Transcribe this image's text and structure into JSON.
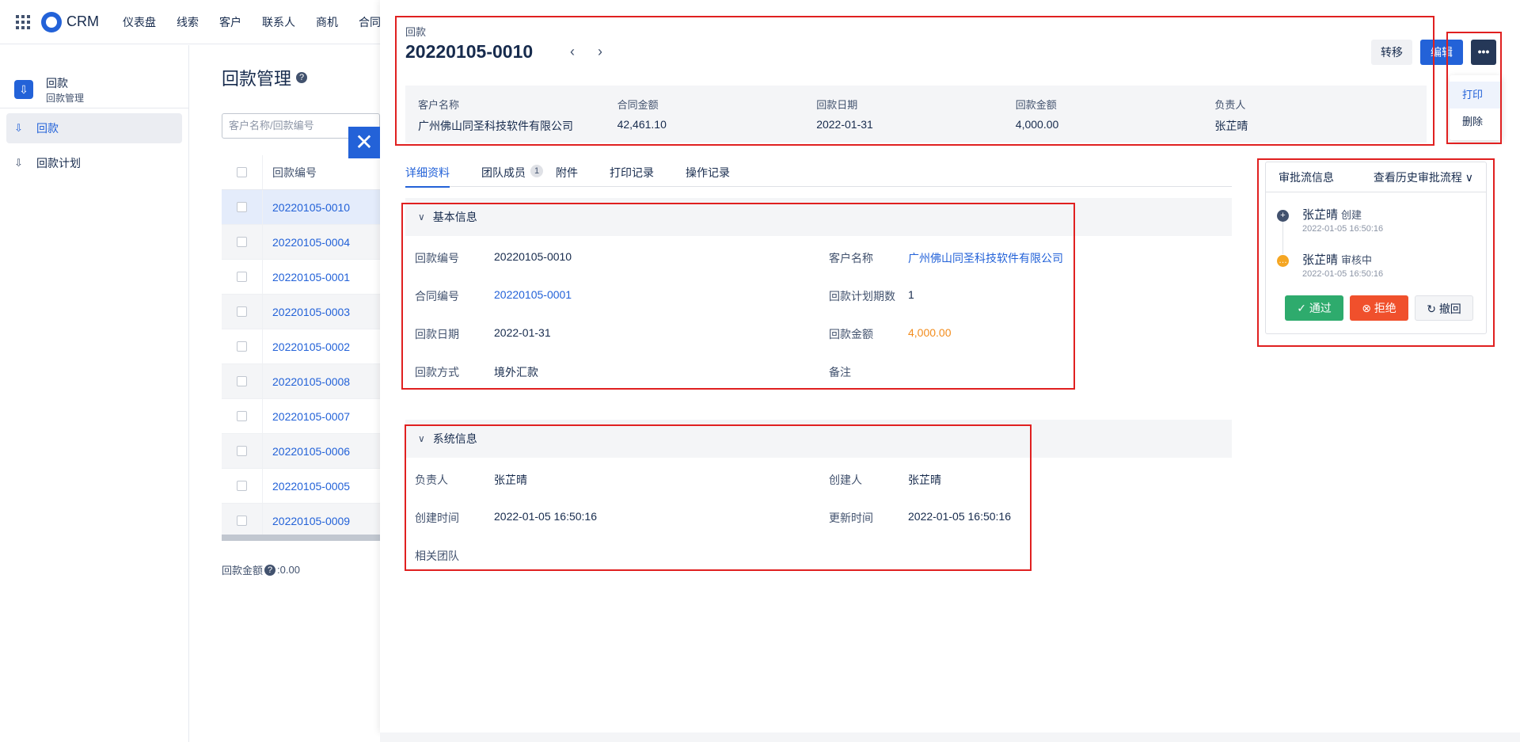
{
  "topnav": {
    "logo_text": "CRM",
    "items": [
      "仪表盘",
      "线索",
      "客户",
      "联系人",
      "商机",
      "合同"
    ]
  },
  "sidebar": {
    "head_title": "回款",
    "head_sub": "回款管理",
    "items": [
      {
        "label": "回款"
      },
      {
        "label": "回款计划"
      }
    ]
  },
  "list": {
    "title": "回款管理",
    "search_placeholder": "客户名称/回款编号",
    "column_header": "回款编号",
    "rows": [
      "20220105-0010",
      "20220105-0004",
      "20220105-0001",
      "20220105-0003",
      "20220105-0002",
      "20220105-0008",
      "20220105-0007",
      "20220105-0006",
      "20220105-0005",
      "20220105-0009"
    ],
    "footer_label": "回款金额",
    "footer_value": ":0.00"
  },
  "detail": {
    "type_label": "回款",
    "title": "20220105-0010",
    "buttons": {
      "transfer": "转移",
      "edit": "编辑",
      "more": "•••"
    },
    "dropdown": [
      "打印",
      "删除"
    ],
    "summary": [
      {
        "label": "客户名称",
        "value": "广州佛山同圣科技软件有限公司"
      },
      {
        "label": "合同金额",
        "value": "42,461.10"
      },
      {
        "label": "回款日期",
        "value": "2022-01-31"
      },
      {
        "label": "回款金额",
        "value": "4,000.00"
      },
      {
        "label": "负责人",
        "value": "张芷晴"
      }
    ],
    "tabs": [
      {
        "label": "详细资料"
      },
      {
        "label": "团队成员",
        "badge": "1"
      },
      {
        "label": "附件"
      },
      {
        "label": "打印记录"
      },
      {
        "label": "操作记录"
      }
    ],
    "basic": {
      "title": "基本信息",
      "fields": {
        "payment_no_label": "回款编号",
        "payment_no": "20220105-0010",
        "customer_label": "客户名称",
        "customer": "广州佛山同圣科技软件有限公司",
        "contract_no_label": "合同编号",
        "contract_no": "20220105-0001",
        "plan_count_label": "回款计划期数",
        "plan_count": "1",
        "date_label": "回款日期",
        "date": "2022-01-31",
        "amount_label": "回款金额",
        "amount": "4,000.00",
        "method_label": "回款方式",
        "method": "境外汇款",
        "remark_label": "备注"
      }
    },
    "system": {
      "title": "系统信息",
      "fields": {
        "owner_label": "负责人",
        "owner": "张芷晴",
        "creator_label": "创建人",
        "creator": "张芷晴",
        "created_label": "创建时间",
        "created": "2022-01-05 16:50:16",
        "updated_label": "更新时间",
        "updated": "2022-01-05 16:50:16",
        "team_label": "相关团队"
      }
    },
    "approval": {
      "title": "审批流信息",
      "history": "查看历史审批流程",
      "steps": [
        {
          "name": "张芷晴",
          "action": "创建",
          "time": "2022-01-05 16:50:16"
        },
        {
          "name": "张芷晴",
          "action": "审核中",
          "time": "2022-01-05 16:50:16"
        }
      ],
      "buttons": {
        "pass": "通过",
        "reject": "拒绝",
        "revoke": "撤回"
      }
    }
  },
  "colors": {
    "accent": "#2362d8",
    "pass": "#2eab6d",
    "reject": "#f0502c",
    "amount": "#f28c1d",
    "highlight_box": "#e02020"
  }
}
